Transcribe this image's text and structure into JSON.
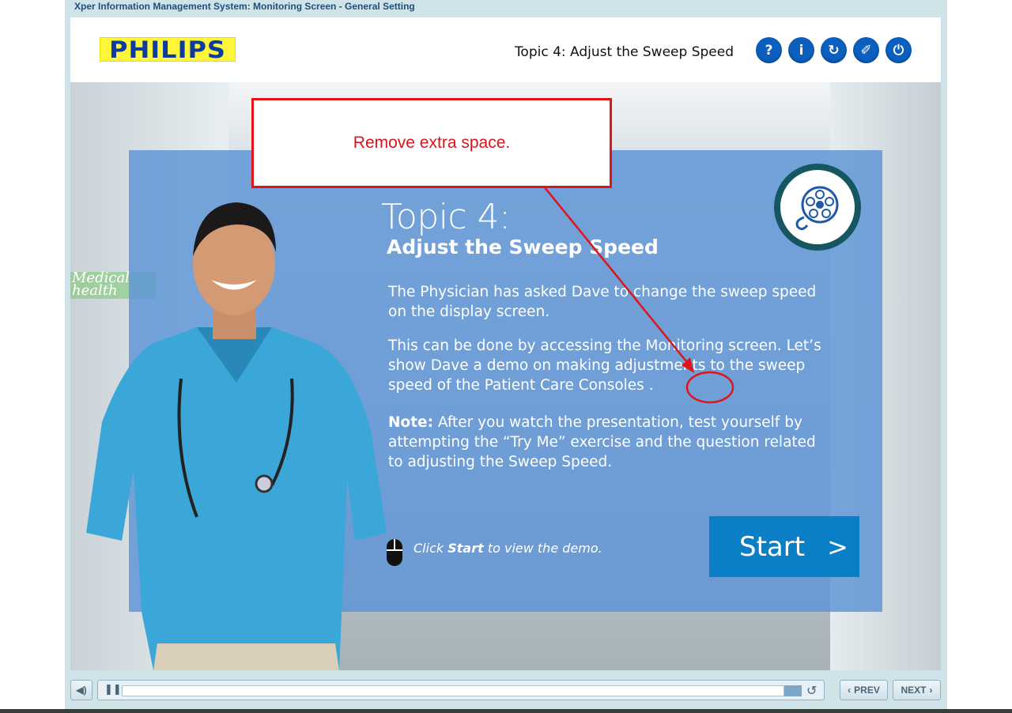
{
  "window": {
    "title": "Xper Information Management System: Monitoring Screen - General Setting"
  },
  "header": {
    "logo_text": "PHILIPS",
    "topic_title": "Topic 4: Adjust the Sweep Speed",
    "buttons": [
      {
        "name": "help",
        "glyph": "?"
      },
      {
        "name": "info",
        "glyph": "i"
      },
      {
        "name": "replay",
        "glyph": "↻"
      },
      {
        "name": "glossary",
        "glyph": "✐"
      },
      {
        "name": "exit",
        "glyph": "⏻"
      }
    ]
  },
  "slide": {
    "heading_line1": "Topic 4:",
    "heading_line2": "Adjust the Sweep Speed",
    "para1": "The Physician has asked Dave to change the sweep speed on the display screen.",
    "para2": "This can be done by accessing the Monitoring screen. Let’s show Dave a demo on making adjustments to the sweep speed of the Patient Care Consoles .",
    "note_label": "Note:",
    "note_text": " After you watch the presentation, test yourself by attempting the “Try Me” exercise and the question related to adjusting the Sweep Speed.",
    "hint_prefix": "Click ",
    "hint_bold": "Start",
    "hint_suffix": " to view the demo.",
    "start_label": "Start",
    "start_chevron": ">",
    "background_sign": "Medical health"
  },
  "annotation": {
    "text": "Remove extra space.",
    "color": "#e0141b"
  },
  "controls": {
    "prev_label": "PREV",
    "next_label": "NEXT",
    "progress": 0.97
  }
}
